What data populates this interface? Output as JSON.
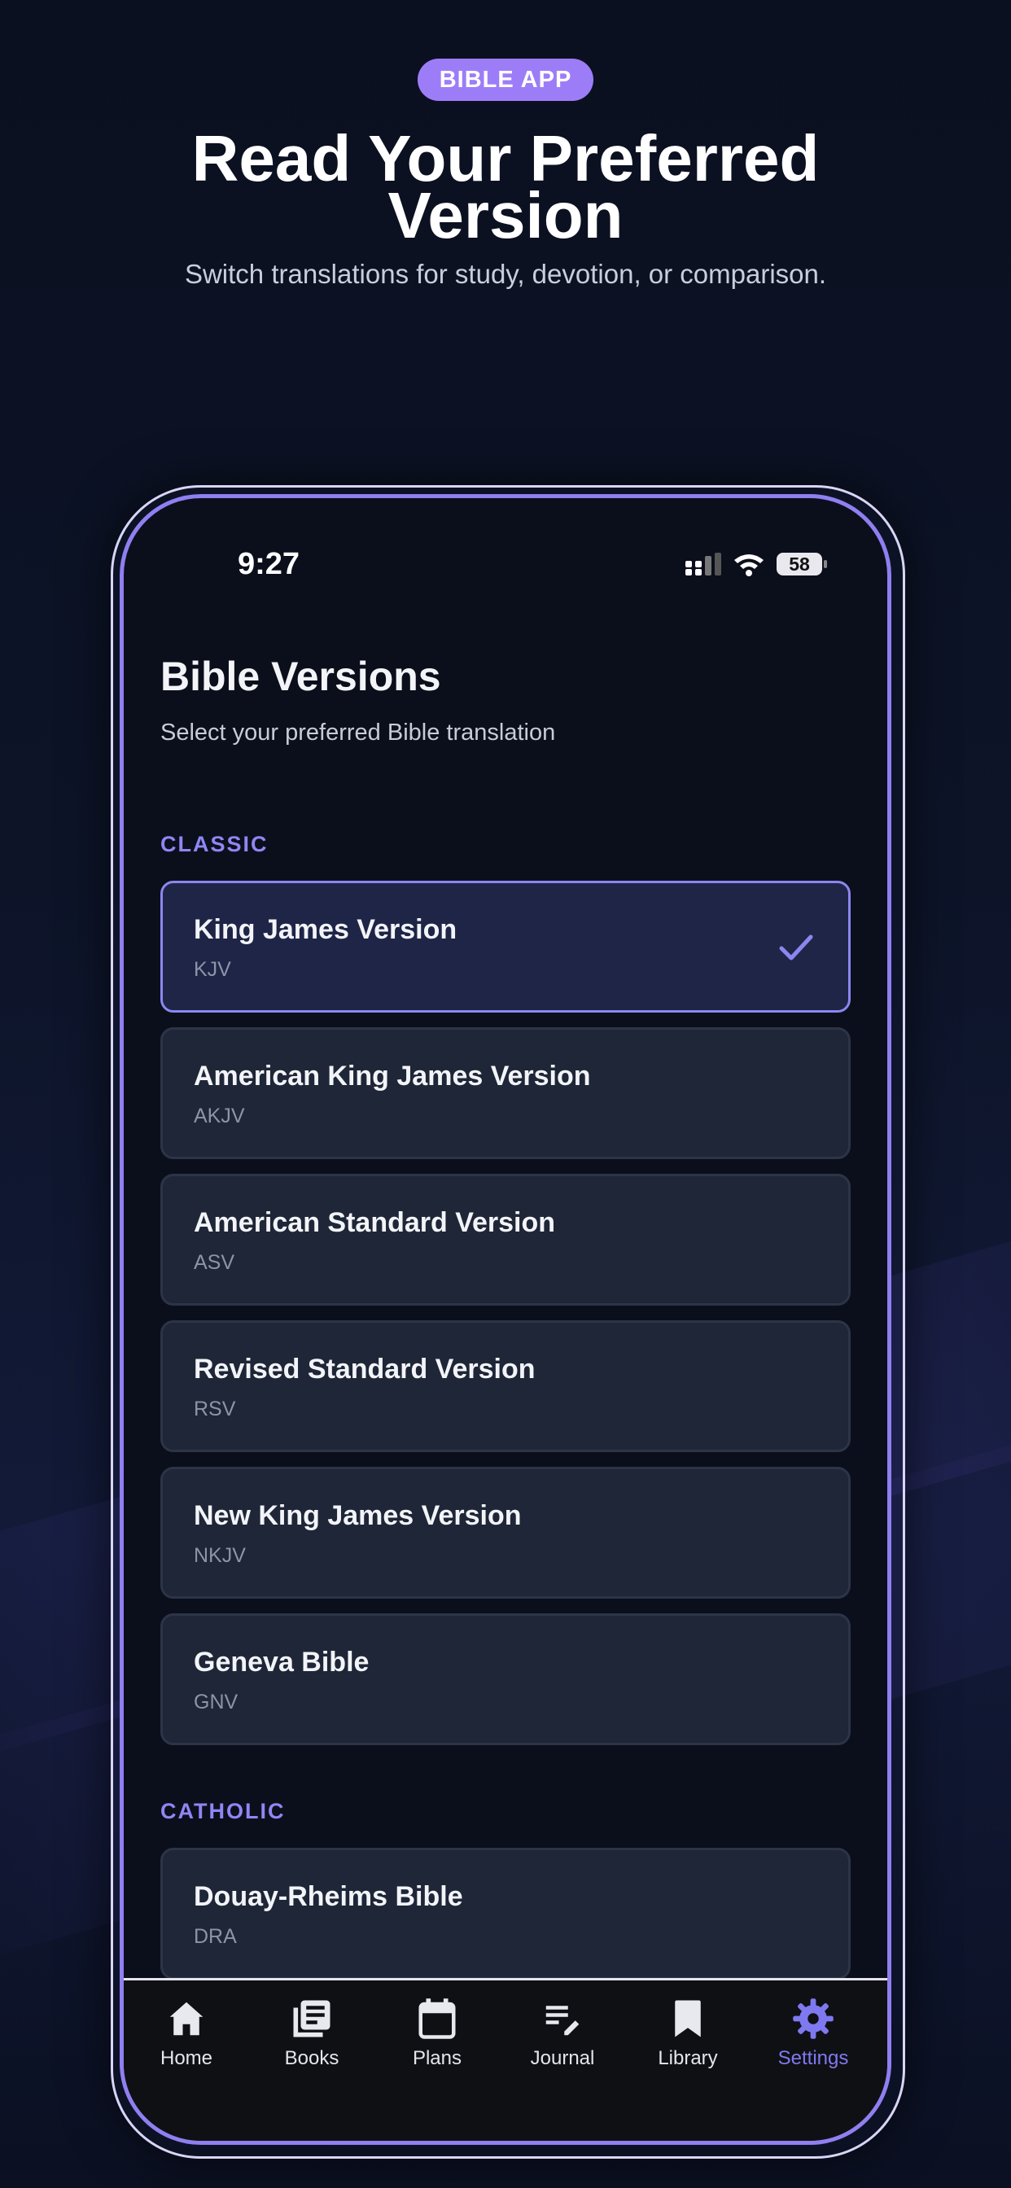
{
  "promo": {
    "badge": "BIBLE APP",
    "headline_line1": "Read Your Preferred",
    "headline_line2": "Version",
    "subtitle": "Switch translations for study, devotion, or comparison."
  },
  "status_bar": {
    "time": "9:27",
    "battery": "58"
  },
  "page": {
    "title": "Bible Versions",
    "subtitle": "Select your preferred Bible translation"
  },
  "sections": [
    {
      "label": "CLASSIC",
      "versions": [
        {
          "name": "King James Version",
          "abbr": "KJV",
          "selected": true
        },
        {
          "name": "American King James Version",
          "abbr": "AKJV"
        },
        {
          "name": "American Standard Version",
          "abbr": "ASV"
        },
        {
          "name": "Revised Standard Version",
          "abbr": "RSV"
        },
        {
          "name": "New King James Version",
          "abbr": "NKJV"
        },
        {
          "name": "Geneva Bible",
          "abbr": "GNV"
        }
      ]
    },
    {
      "label": "CATHOLIC",
      "versions": [
        {
          "name": "Douay-Rheims Bible",
          "abbr": "DRA"
        }
      ]
    }
  ],
  "tabs": [
    {
      "label": "Home",
      "icon": "home-icon"
    },
    {
      "label": "Books",
      "icon": "books-icon"
    },
    {
      "label": "Plans",
      "icon": "calendar-icon"
    },
    {
      "label": "Journal",
      "icon": "journal-edit-icon"
    },
    {
      "label": "Library",
      "icon": "bookmark-icon"
    },
    {
      "label": "Settings",
      "icon": "gear-icon",
      "active": true
    }
  ],
  "colors": {
    "accent": "#8f86f4",
    "badge": "#9d7df7",
    "card": "#1e2637",
    "selected_card": "#1f2547"
  }
}
